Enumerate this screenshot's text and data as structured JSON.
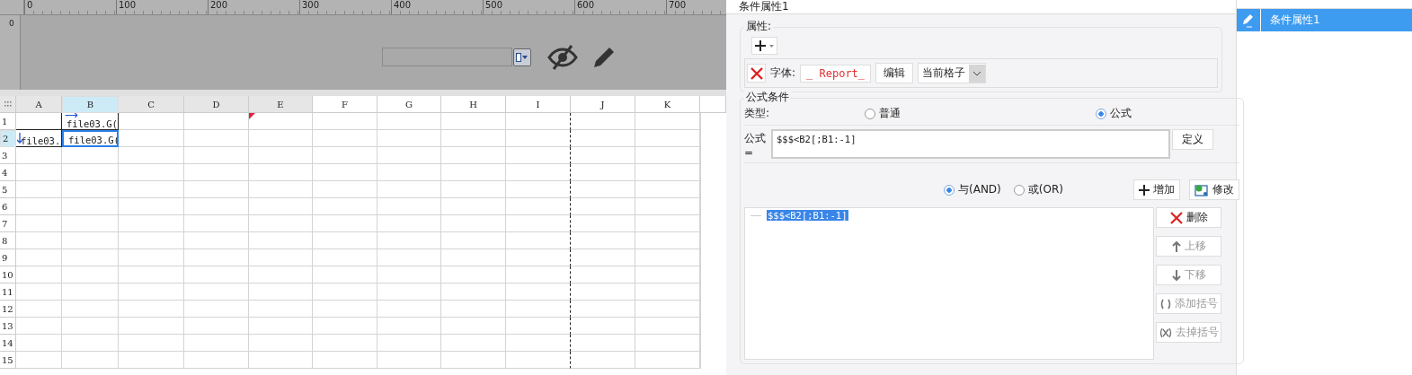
{
  "ruler": {
    "labels": [
      "0",
      "100",
      "200",
      "300",
      "400",
      "500",
      "600",
      "700"
    ],
    "side_label": "0"
  },
  "sheet": {
    "columns": [
      {
        "label": "A",
        "selected": false
      },
      {
        "label": "B",
        "selected": true
      },
      {
        "label": "C",
        "selected": false
      },
      {
        "label": "D",
        "selected": false
      },
      {
        "label": "E",
        "selected": false
      },
      {
        "label": "F",
        "selected": false
      },
      {
        "label": "G",
        "selected": false
      },
      {
        "label": "H",
        "selected": false
      },
      {
        "label": "I",
        "selected": false
      },
      {
        "label": "J",
        "selected": false
      },
      {
        "label": "K",
        "selected": false
      }
    ],
    "rows": [
      {
        "label": "1",
        "selected": false,
        "cells": [
          {
            "kind": "empty"
          },
          {
            "kind": "text",
            "text": "file03.G(",
            "expands_right": true,
            "expands_down": false,
            "selected": false
          }
        ]
      },
      {
        "label": "2",
        "selected": true,
        "cells": [
          {
            "kind": "text",
            "text": "file03.",
            "expands_right": false,
            "expands_down": true,
            "selected": false
          },
          {
            "kind": "text",
            "text": "file03.G(",
            "expands_right": false,
            "expands_down": false,
            "selected": true
          }
        ]
      },
      {
        "label": "3",
        "selected": false
      },
      {
        "label": "4",
        "selected": false
      },
      {
        "label": "5",
        "selected": false
      },
      {
        "label": "6",
        "selected": false
      },
      {
        "label": "7",
        "selected": false
      },
      {
        "label": "8",
        "selected": false
      },
      {
        "label": "9",
        "selected": false
      },
      {
        "label": "10",
        "selected": false
      },
      {
        "label": "11",
        "selected": false
      },
      {
        "label": "12",
        "selected": false
      },
      {
        "label": "13",
        "selected": false
      },
      {
        "label": "14",
        "selected": false
      },
      {
        "label": "15",
        "selected": false
      }
    ]
  },
  "panel": {
    "title": "条件属性1",
    "attributes": {
      "label": "属性:",
      "font_label": "字体:",
      "font_preview": "_ Report_",
      "edit_button": "编辑",
      "scope": "当前格子"
    },
    "formula": {
      "label": "公式条件",
      "type_label": "类型:",
      "types": [
        {
          "label": "普通",
          "selected": false
        },
        {
          "label": "公式",
          "selected": true
        }
      ],
      "formula_label": "公式=",
      "value": "$$$<B2[;B1:-1]",
      "define_button": "定义"
    },
    "logic": [
      {
        "label": "与(AND)",
        "selected": true
      },
      {
        "label": "或(OR)",
        "selected": false
      }
    ],
    "add_button": "增加",
    "modify_button": "修改",
    "conditions": [
      {
        "text": "$$$<B2[;B1:-1]",
        "selected": true
      }
    ],
    "actions": [
      {
        "kind": "delete",
        "label": "删除",
        "disabled": false
      },
      {
        "kind": "up",
        "label": "上移",
        "disabled": true
      },
      {
        "kind": "down",
        "label": "下移",
        "disabled": true
      },
      {
        "kind": "addparen",
        "label": "添加括号",
        "disabled": true
      },
      {
        "kind": "removeparen",
        "label": "去掉括号",
        "disabled": true
      }
    ]
  },
  "list": {
    "items": [
      {
        "label": "条件属性1",
        "selected": true
      }
    ]
  }
}
